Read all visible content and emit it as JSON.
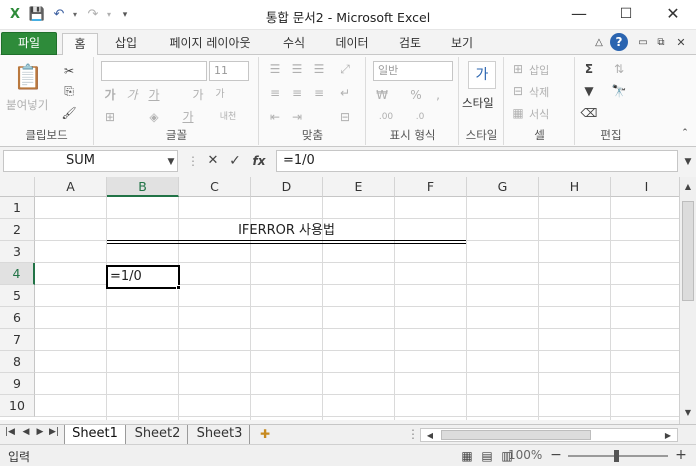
{
  "window": {
    "title": "통합 문서2 - Microsoft Excel",
    "minimize": "—",
    "maximize": "☐",
    "close": "✕"
  },
  "qat": {
    "save_icon": "save-icon",
    "undo_icon": "undo-icon",
    "redo_icon": "redo-icon",
    "customize_icon": "customize-icon"
  },
  "tabs": {
    "file": "파일",
    "home": "홈",
    "insert": "삽입",
    "layout": "페이지 레이아웃",
    "formulas": "수식",
    "data": "데이터",
    "review": "검토",
    "view": "보기"
  },
  "ribbon": {
    "clipboard": {
      "label": "클립보드",
      "paste": "붙여넣기"
    },
    "font": {
      "label": "글꼴",
      "font_name": "",
      "font_size": "11",
      "bold": "가",
      "italic": "가",
      "underline": "가",
      "grow": "가",
      "shrink": "가",
      "phonetic": "내천"
    },
    "alignment": {
      "label": "맞춤"
    },
    "number": {
      "label": "표시 형식",
      "format": "일반",
      "percent": "%",
      "comma": ",",
      "dec_inc": ".00",
      "dec_dec": ".0"
    },
    "styles": {
      "label": "스타일",
      "styles_button": "스타일"
    },
    "cells": {
      "label": "셀",
      "insert": "삽입",
      "delete": "삭제",
      "format": "서식"
    },
    "editing": {
      "label": "편집",
      "sum": "Σ"
    }
  },
  "formula_bar": {
    "name_box": "SUM",
    "cancel": "✕",
    "enter": "✓",
    "fx": "fx",
    "value": "=1/0"
  },
  "grid": {
    "columns": [
      "A",
      "B",
      "C",
      "D",
      "E",
      "F",
      "G",
      "H",
      "I"
    ],
    "rows": [
      "1",
      "2",
      "3",
      "4",
      "5",
      "6",
      "7",
      "8",
      "9",
      "10"
    ],
    "cells": {
      "B2": "IFERROR 사용법",
      "B4": "=1/0"
    },
    "active_cell": "B4"
  },
  "sheets": [
    "Sheet1",
    "Sheet2",
    "Sheet3"
  ],
  "active_sheet": "Sheet1",
  "status": {
    "mode": "입력",
    "zoom": "100%",
    "zoom_out": "−",
    "zoom_in": "+"
  }
}
